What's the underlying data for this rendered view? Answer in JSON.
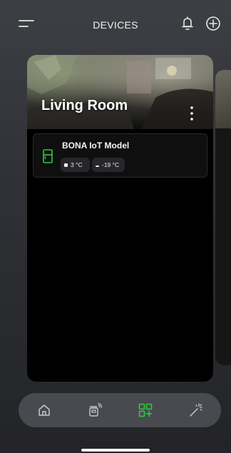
{
  "header": {
    "title": "DEVICES",
    "menu_icon": "hamburger-menu-icon",
    "notification_icon": "bell-icon",
    "add_icon": "plus-circle-icon"
  },
  "room_card": {
    "title": "Living Room",
    "more_icon": "vertical-dots-icon",
    "devices": [
      {
        "name": "BONA IoT Model",
        "icon": "fridge-icon",
        "icon_color": "#2ecc40",
        "chips": [
          {
            "icon": "square-dot-icon",
            "value": "3 °C"
          },
          {
            "icon": "dash-icon",
            "value": "-19 °C"
          }
        ]
      }
    ]
  },
  "bottom_nav": {
    "items": [
      {
        "name": "home",
        "icon": "home-icon",
        "active": false
      },
      {
        "name": "devices",
        "icon": "remote-device-icon",
        "active": false
      },
      {
        "name": "add-device",
        "icon": "grid-add-icon",
        "active": true
      },
      {
        "name": "magic",
        "icon": "magic-wand-icon",
        "active": false
      }
    ],
    "active_color": "#2ecc40",
    "inactive_color": "#c8c8c8"
  }
}
